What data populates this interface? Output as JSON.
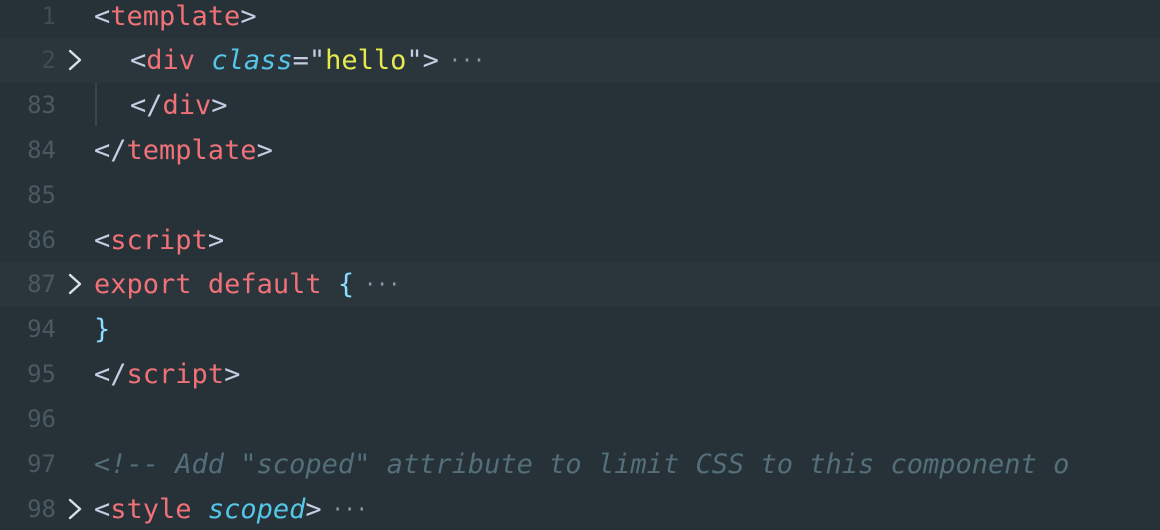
{
  "colors": {
    "background": "#263238",
    "gutter_number": "#4b5a60",
    "tag": "#f07178",
    "attribute": "#55c6e7",
    "string": "#e7ea4f",
    "punctuation": "#c3cee3",
    "comment": "#546e7a"
  },
  "lines": [
    {
      "number": "1",
      "parts": {
        "open": "<",
        "tag": "template",
        "close": ">"
      }
    },
    {
      "number": "2",
      "parts": {
        "open": "<",
        "tag": "div",
        "attr": "class",
        "eq": "=\"",
        "str": "hello",
        "eq2": "\"",
        "close": ">",
        "ellipsis": "···"
      }
    },
    {
      "number": "83",
      "parts": {
        "open": "</",
        "tag": "div",
        "close": ">"
      }
    },
    {
      "number": "84",
      "parts": {
        "open": "</",
        "tag": "template",
        "close": ">"
      }
    },
    {
      "number": "85"
    },
    {
      "number": "86",
      "parts": {
        "open": "<",
        "tag": "script",
        "close": ">"
      }
    },
    {
      "number": "87",
      "parts": {
        "kw1": "export",
        "kw2": "default",
        "brace": "{",
        "ellipsis": "···"
      }
    },
    {
      "number": "94",
      "parts": {
        "brace": "}"
      }
    },
    {
      "number": "95",
      "parts": {
        "open": "</",
        "tag": "script",
        "close": ">"
      }
    },
    {
      "number": "96"
    },
    {
      "number": "97",
      "parts": {
        "comment": "<!-- Add \"scoped\" attribute to limit CSS to this component o"
      }
    },
    {
      "number": "98",
      "parts": {
        "open": "<",
        "tag": "style",
        "attr": "scoped",
        "close": ">",
        "ellipsis": "···"
      }
    }
  ],
  "fold_icon": "chevron-right-icon"
}
